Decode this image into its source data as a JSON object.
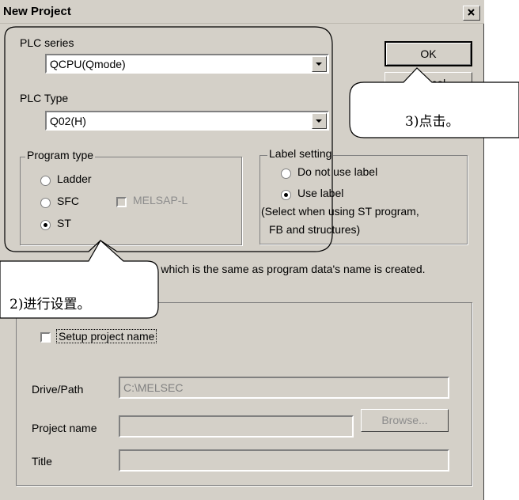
{
  "window": {
    "title": "New Project",
    "close_glyph": "✕"
  },
  "plc_series": {
    "label": "PLC series",
    "value": "QCPU(Qmode)"
  },
  "plc_type": {
    "label": "PLC Type",
    "value": "Q02(H)"
  },
  "buttons": {
    "ok": "OK",
    "cancel": "Cancel",
    "browse": "Browse..."
  },
  "program_type": {
    "legend": "Program type",
    "options": [
      {
        "label": "Ladder",
        "selected": false
      },
      {
        "label": "SFC",
        "selected": false
      },
      {
        "label": "ST",
        "selected": true
      }
    ],
    "melsap_label": "MELSAP-L",
    "melsap_checked": false
  },
  "label_setting": {
    "legend": "Label setting",
    "options": [
      {
        "label": "Do not use label",
        "selected": false
      },
      {
        "label": "Use label",
        "selected": true
      }
    ],
    "note_line1": "(Select when using ST program,",
    "note_line2": "FB and structures)"
  },
  "device_memory_text": "ata which is the same as program data's name is created.",
  "project": {
    "setup_label": "Setup project name",
    "setup_checked": false,
    "drive_path_label": "Drive/Path",
    "drive_path_value": "C:\\MELSEC",
    "project_name_label": "Project name",
    "project_name_value": "",
    "title_label": "Title",
    "title_value": ""
  },
  "callouts": {
    "setting": "2)进行设置。",
    "click": "3)点击。"
  }
}
